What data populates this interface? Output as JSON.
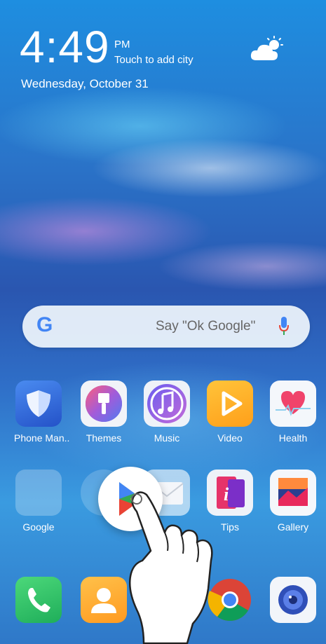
{
  "clock": {
    "time": "4:49",
    "ampm": "PM",
    "city_prompt": "Touch to add city",
    "date": "Wednesday, October 31"
  },
  "weather": {
    "icon": "partly-cloudy-icon"
  },
  "search": {
    "logo": "G",
    "hint": "Say \"Ok Google\"",
    "mic_icon": "mic-icon"
  },
  "apps_row1": [
    {
      "label": "Phone Man..",
      "icon": "shield-icon"
    },
    {
      "label": "Themes",
      "icon": "paintbrush-icon"
    },
    {
      "label": "Music",
      "icon": "music-note-icon"
    },
    {
      "label": "Video",
      "icon": "play-icon"
    },
    {
      "label": "Health",
      "icon": "heart-icon"
    }
  ],
  "apps_row2": [
    {
      "label": "Google",
      "icon": "folder-icon"
    },
    {
      "label": "",
      "icon": "toggle-icon"
    },
    {
      "label": "",
      "icon": "email-icon"
    },
    {
      "label": "Tips",
      "icon": "tips-icon"
    },
    {
      "label": "Gallery",
      "icon": "gallery-icon"
    }
  ],
  "dock": [
    {
      "icon": "phone-icon"
    },
    {
      "icon": "contacts-icon"
    },
    {
      "icon": "messages-icon"
    },
    {
      "icon": "chrome-icon"
    },
    {
      "icon": "camera-icon"
    }
  ],
  "drag_item": {
    "icon": "play-store-icon"
  },
  "gesture": {
    "icon": "hand-pointer-icon"
  }
}
